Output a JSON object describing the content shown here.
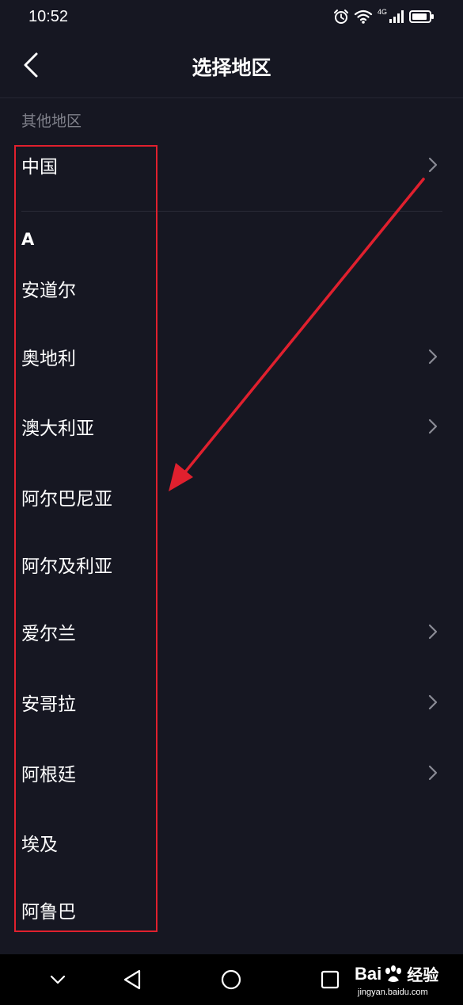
{
  "status_bar": {
    "time": "10:52",
    "network_label": "4G",
    "icons": [
      "alarm-icon",
      "wifi-icon",
      "cellular-signal-icon",
      "battery-icon"
    ]
  },
  "header": {
    "title": "选择地区",
    "back_icon": "back-arrow-icon"
  },
  "other_section": {
    "label": "其他地区",
    "items": [
      {
        "label": "中国",
        "has_chevron": true
      }
    ]
  },
  "a_section": {
    "letter": "A",
    "items": [
      {
        "label": "安道尔",
        "has_chevron": false
      },
      {
        "label": "奥地利",
        "has_chevron": true
      },
      {
        "label": "澳大利亚",
        "has_chevron": true
      },
      {
        "label": "阿尔巴尼亚",
        "has_chevron": false
      },
      {
        "label": "阿尔及利亚",
        "has_chevron": false
      },
      {
        "label": "爱尔兰",
        "has_chevron": true
      },
      {
        "label": "安哥拉",
        "has_chevron": true
      },
      {
        "label": "阿根廷",
        "has_chevron": true
      },
      {
        "label": "埃及",
        "has_chevron": false
      },
      {
        "label": "阿鲁巴",
        "has_chevron": false
      }
    ]
  },
  "nav_bar": {
    "buttons": [
      "chevron-down-icon",
      "back-triangle-icon",
      "home-circle-icon",
      "recents-square-icon"
    ]
  },
  "watermark": {
    "brand_left": "Bai",
    "brand_right": "经验",
    "url": "jingyan.baidu.com"
  },
  "colors": {
    "background": "#161722",
    "text": "#ffffff",
    "secondary_text": "#7f808a",
    "annotation_red": "#e0202e"
  }
}
